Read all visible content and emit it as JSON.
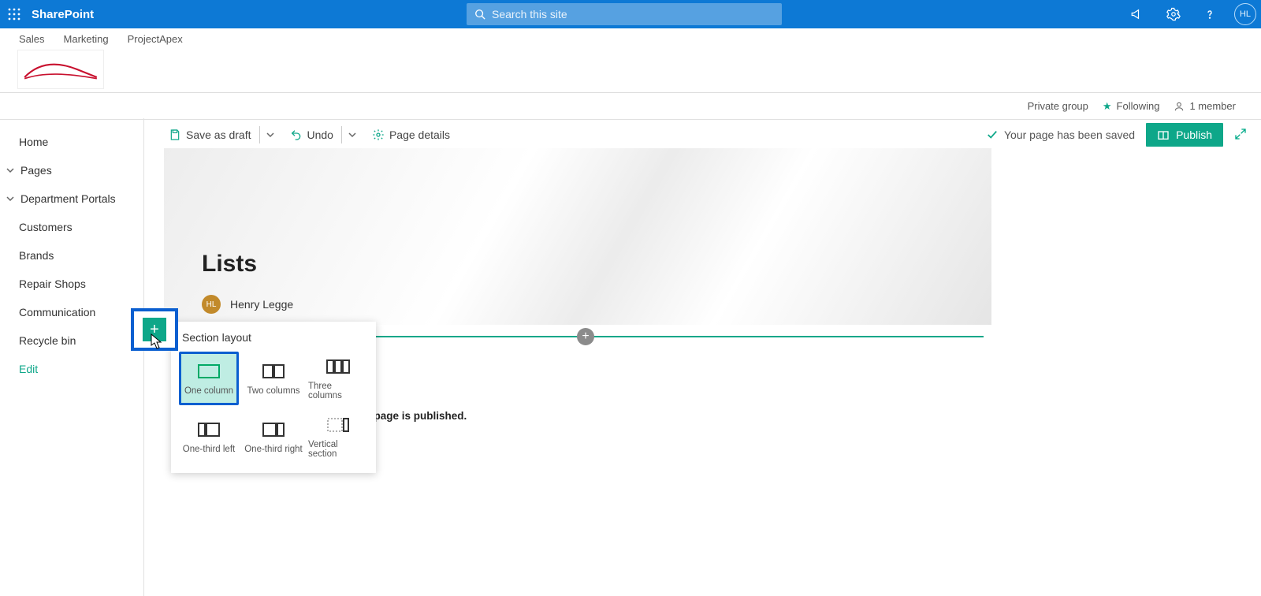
{
  "topbar": {
    "app": "SharePoint",
    "search_placeholder": "Search this site",
    "avatar_initials": "HL"
  },
  "hub_links": [
    "Sales",
    "Marketing",
    "ProjectApex"
  ],
  "member_row": {
    "privacy": "Private group",
    "follow": "Following",
    "members": "1 member"
  },
  "commands": {
    "save": "Save as draft",
    "undo": "Undo",
    "details": "Page details",
    "saved_msg": "Your page has been saved",
    "publish": "Publish"
  },
  "sidenav": {
    "items": [
      {
        "label": "Home",
        "expand": false
      },
      {
        "label": "Pages",
        "expand": true
      },
      {
        "label": "Department Portals",
        "expand": true
      },
      {
        "label": "Customers",
        "expand": false
      },
      {
        "label": "Brands",
        "expand": false
      },
      {
        "label": "Repair Shops",
        "expand": false
      },
      {
        "label": "Communication",
        "expand": false
      },
      {
        "label": "Recycle bin",
        "expand": false
      }
    ],
    "edit": "Edit"
  },
  "page": {
    "title": "Lists",
    "author_initials": "HL",
    "author_name": "Henry Legge",
    "truncated_suffix": "he page is published."
  },
  "popover": {
    "title": "Section layout",
    "options": [
      "One column",
      "Two columns",
      "Three columns",
      "One-third left",
      "One-third right",
      "Vertical section"
    ]
  }
}
